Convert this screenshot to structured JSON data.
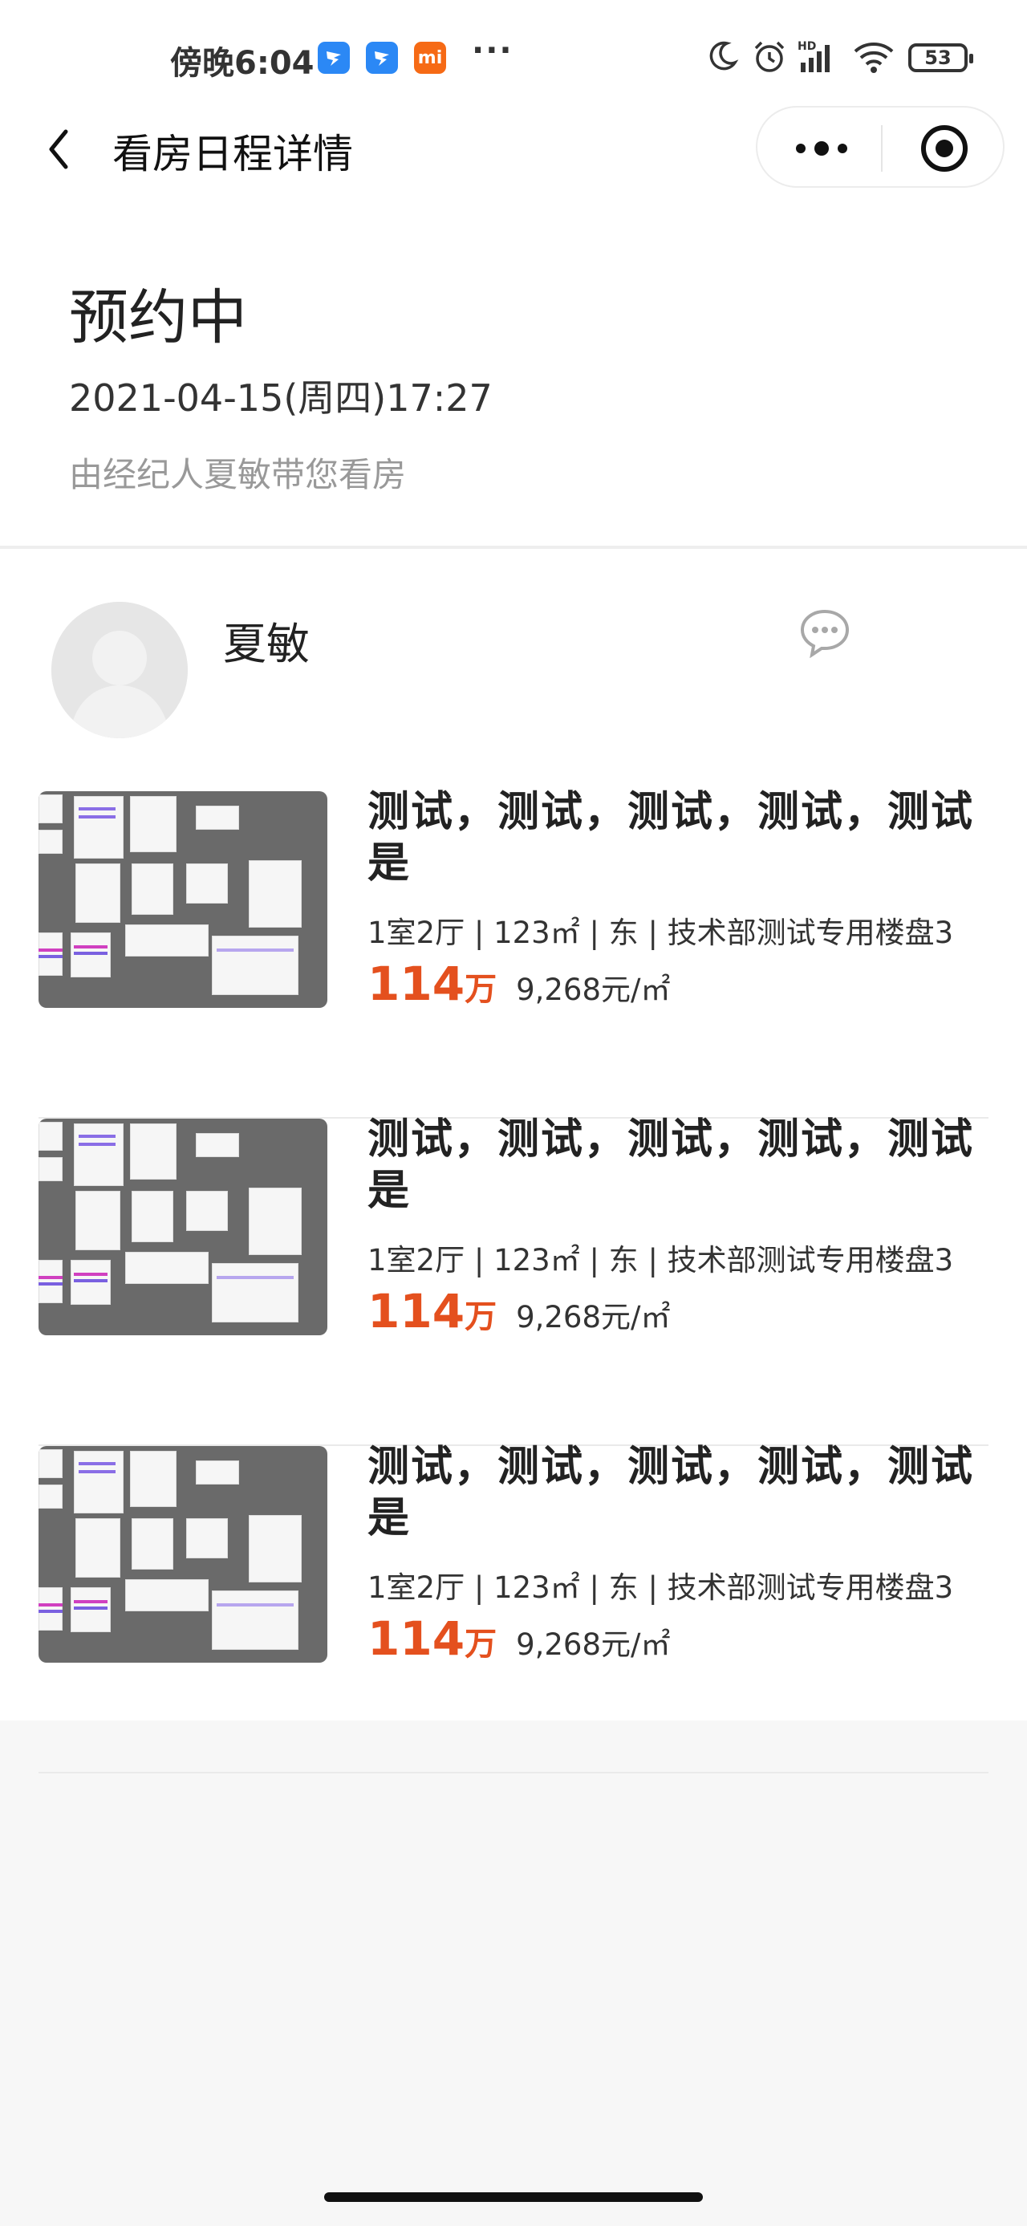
{
  "status_bar": {
    "time": "傍晚6:04",
    "app_badges": [
      {
        "name": "dingtalk",
        "label": "",
        "color": "#2b88f5"
      },
      {
        "name": "dingtalk",
        "label": "",
        "color": "#2b88f5"
      },
      {
        "name": "xiaomi",
        "label": "mi",
        "color": "#f66a15"
      }
    ],
    "more_dots": "···",
    "battery_level": "53"
  },
  "nav": {
    "title": "看房日程详情"
  },
  "schedule": {
    "status": "预约中",
    "datetime": "2021-04-15(周四)17:27",
    "agent_note": "由经纪人夏敏带您看房"
  },
  "agent": {
    "name": "夏敏"
  },
  "listings": [
    {
      "title": "测试，测试，测试，测试，测试是",
      "meta": "1室2厅 | 123㎡ | 东 | 技术部测试专用楼盘3",
      "price": "114",
      "price_unit": "万",
      "unit_price": "9,268元/㎡"
    },
    {
      "title": "测试，测试，测试，测试，测试是",
      "meta": "1室2厅 | 123㎡ | 东 | 技术部测试专用楼盘3",
      "price": "114",
      "price_unit": "万",
      "unit_price": "9,268元/㎡"
    },
    {
      "title": "测试，测试，测试，测试，测试是",
      "meta": "1室2厅 | 123㎡ | 东 | 技术部测试专用楼盘3",
      "price": "114",
      "price_unit": "万",
      "unit_price": "9,268元/㎡"
    }
  ],
  "colors": {
    "accent_price": "#e4501e",
    "muted_text": "#999999"
  }
}
